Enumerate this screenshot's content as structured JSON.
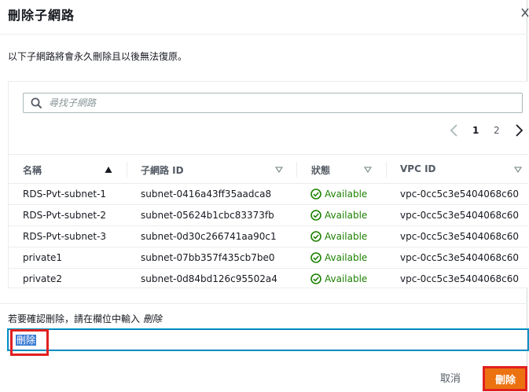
{
  "dialog": {
    "title": "刪除子網路",
    "warning": "以下子網路將會永久刪除且以後無法復原。"
  },
  "search": {
    "placeholder": "尋找子網路"
  },
  "pagination": {
    "pages": [
      "1",
      "2"
    ],
    "current": "1"
  },
  "table": {
    "columns": [
      "名稱",
      "子網路 ID",
      "狀態",
      "VPC ID"
    ],
    "sorted_column": "名稱",
    "rows": [
      {
        "name": "RDS-Pvt-subnet-1",
        "subnet_id": "subnet-0416a43ff35aadca8",
        "status": "Available",
        "vpc_id": "vpc-0cc5c3e5404068c60"
      },
      {
        "name": "RDS-Pvt-subnet-2",
        "subnet_id": "subnet-05624b1cbc83373fb",
        "status": "Available",
        "vpc_id": "vpc-0cc5c3e5404068c60"
      },
      {
        "name": "RDS-Pvt-subnet-3",
        "subnet_id": "subnet-0d30c266741aa90c1",
        "status": "Available",
        "vpc_id": "vpc-0cc5c3e5404068c60"
      },
      {
        "name": "private1",
        "subnet_id": "subnet-07bb357f435cb7be0",
        "status": "Available",
        "vpc_id": "vpc-0cc5c3e5404068c60"
      },
      {
        "name": "private2",
        "subnet_id": "subnet-0d84bd126c95502a4",
        "status": "Available",
        "vpc_id": "vpc-0cc5c3e5404068c60"
      }
    ]
  },
  "confirm": {
    "label_prefix": "若要確認刪除，請在欄位中輸入",
    "label_keyword": "刪除",
    "input_value": "刪除"
  },
  "buttons": {
    "cancel": "取消",
    "delete": "刪除"
  },
  "colors": {
    "primary": "#ec7211",
    "success": "#1d8102",
    "focus": "#0073bb",
    "highlight": "#e02020"
  }
}
